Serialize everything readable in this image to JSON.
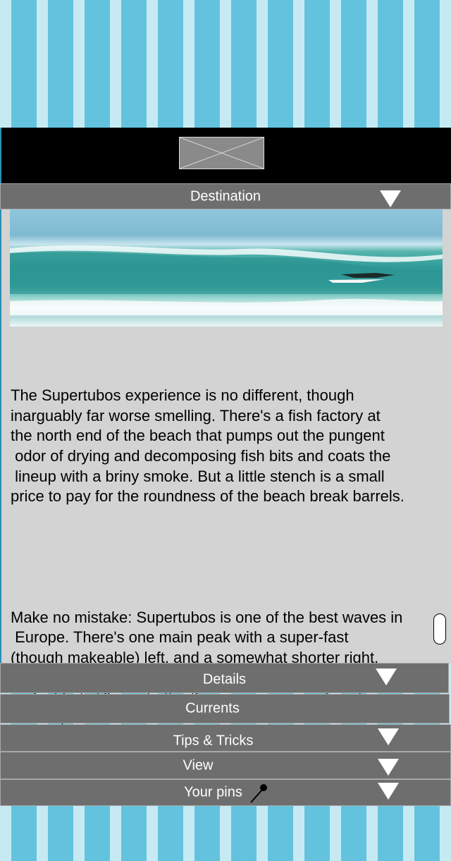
{
  "sections": {
    "destination": "Destination",
    "details": "Details",
    "currents": "Currents",
    "tips": "Tips & Tricks",
    "view": "View",
    "pins": "Your pins"
  },
  "body": {
    "paragraph1": "The Supertubos experience is no different, though\ninarguably far worse smelling. There's a fish factory at\nthe north end of the beach that pumps out the pungent\n odor of drying and decomposing fish bits and coats the\n lineup with a briny smoke. But a little stench is a small\nprice to pay for the roundness of the beach break barrels.",
    "paragraph2": "Make no mistake: Supertubos is one of the best waves in\n Europe. There's one main peak with a super-fast\n(though makeable) left, and a somewhat shorter right,\nand one other peak down the beach that's not quite as\nperfect but still way better than your average day at\nHuntington Pier."
  },
  "icons": {
    "expand": "triangle-down-icon",
    "pin": "pin-icon",
    "logo": "image-placeholder-icon"
  },
  "colors": {
    "stripe_light": "#c6eaf3",
    "stripe_dark": "#63c3de",
    "bar": "#6e6e6e",
    "panel": "#d3d3d3"
  }
}
